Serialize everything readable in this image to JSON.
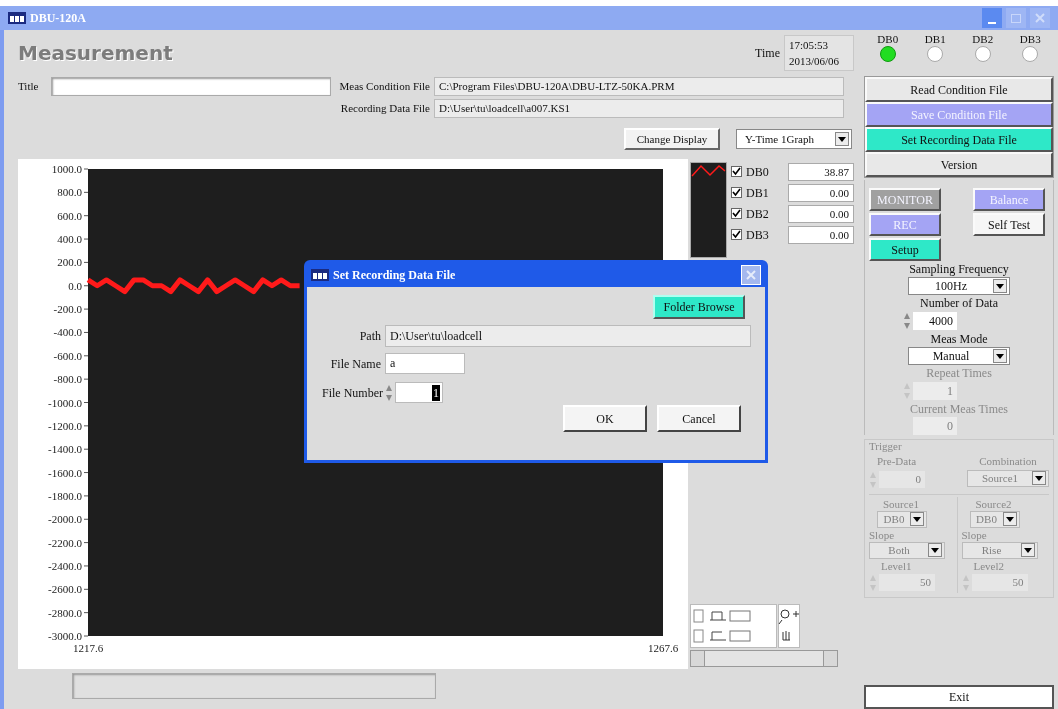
{
  "window": {
    "title": "DBU-120A"
  },
  "heading": "Measurement",
  "time": {
    "label": "Time",
    "clock": "17:05:53",
    "date": "2013/06/06"
  },
  "title_field": {
    "label": "Title"
  },
  "condition_file": {
    "label": "Meas Condition File",
    "value": "C:\\Program Files\\DBU-120A\\DBU-LTZ-50KA.PRM"
  },
  "recording_file": {
    "label": "Recording Data File",
    "value": "D:\\User\\tu\\loadcell\\a007.KS1"
  },
  "change_display": "Change Display",
  "display_mode": "Y-Time 1Graph",
  "chart_data": {
    "type": "line",
    "xlim": [
      1217.6,
      1267.6
    ],
    "ylim": [
      -3000,
      1000
    ],
    "xticks": [
      1217.6,
      1267.6
    ],
    "yticks": [
      {
        "value": 1000,
        "label": "1000.0"
      },
      {
        "value": 800,
        "label": "800.0"
      },
      {
        "value": 600,
        "label": "600.0"
      },
      {
        "value": 400,
        "label": "400.0"
      },
      {
        "value": 200,
        "label": "200.0"
      },
      {
        "value": 0,
        "label": "0.0"
      },
      {
        "value": -200,
        "label": "-200.0"
      },
      {
        "value": -400,
        "label": "-400.0"
      },
      {
        "value": -600,
        "label": "-600.0"
      },
      {
        "value": -800,
        "label": "-800.0"
      },
      {
        "value": -1000,
        "label": "-1000.0"
      },
      {
        "value": -1200,
        "label": "-1200.0"
      },
      {
        "value": -1400,
        "label": "-1400.0"
      },
      {
        "value": -1600,
        "label": "-1600.0"
      },
      {
        "value": -1800,
        "label": "-1800.0"
      },
      {
        "value": -2000,
        "label": "-2000.0"
      },
      {
        "value": -2200,
        "label": "-2200.0"
      },
      {
        "value": -2400,
        "label": "-2400.0"
      },
      {
        "value": -2600,
        "label": "-2600.0"
      },
      {
        "value": -2800,
        "label": "-2800.0"
      },
      {
        "value": -3000,
        "label": "-3000.0"
      }
    ],
    "x": [
      1217.6,
      1218.4,
      1219.2,
      1220.0,
      1220.8,
      1221.6,
      1222.4,
      1223.2,
      1224.0,
      1224.8,
      1225.6,
      1226.4,
      1227.2,
      1228.0,
      1228.8,
      1229.6,
      1230.4,
      1231.2,
      1232.0,
      1232.8,
      1233.6,
      1234.4,
      1235.2,
      1236.0
    ],
    "series": [
      {
        "color": "#ff1a1a",
        "values": [
          50,
          0,
          50,
          0,
          -50,
          50,
          50,
          0,
          0,
          -50,
          50,
          0,
          -50,
          50,
          -50,
          0,
          50,
          0,
          -50,
          50,
          0,
          50,
          0,
          0
        ]
      }
    ]
  },
  "legend_channels": [
    {
      "label": "DB0",
      "checked": true,
      "value": "38.87"
    },
    {
      "label": "DB1",
      "checked": true,
      "value": "0.00"
    },
    {
      "label": "DB2",
      "checked": true,
      "value": "0.00"
    },
    {
      "label": "DB3",
      "checked": true,
      "value": "0.00"
    }
  ],
  "channels": [
    {
      "label": "DB0",
      "on": true
    },
    {
      "label": "DB1",
      "on": false
    },
    {
      "label": "DB2",
      "on": false
    },
    {
      "label": "DB3",
      "on": false
    }
  ],
  "file_buttons": [
    {
      "label": "Read Condition File",
      "color": "#e8e8e8",
      "dimmed": false
    },
    {
      "label": "Save Condition File",
      "color": "#a4a4f4",
      "dimmed": true
    },
    {
      "label": "Set Recording Data File",
      "color": "#2ee8c8",
      "dimmed": false
    },
    {
      "label": "Version",
      "color": "#e8e8e8",
      "dimmed": false
    }
  ],
  "mode_buttons": [
    {
      "label": "MONITOR",
      "color": "#a0a0a0",
      "dimmed": true
    },
    {
      "label": "REC",
      "color": "#a4a4f4",
      "dimmed": true
    },
    {
      "label": "Setup",
      "color": "#2ee8c8",
      "dimmed": false
    },
    {
      "label": "Balance",
      "color": "#a4a4f4",
      "dimmed": true
    },
    {
      "label": "Self Test",
      "color": "#f6f6f6",
      "dimmed": false
    }
  ],
  "settings": [
    {
      "kind": "dropdown",
      "label": "Sampling Frequency",
      "value": "100Hz",
      "disabled": false
    },
    {
      "kind": "spinner",
      "label": "Number of Data",
      "value": "4000",
      "disabled": false
    },
    {
      "kind": "dropdown",
      "label": "Meas Mode",
      "value": "Manual",
      "disabled": false
    },
    {
      "kind": "spinner",
      "label": "Repeat Times",
      "value": "1",
      "disabled": true
    },
    {
      "kind": "readout",
      "label": "Current Meas Times",
      "value": "0",
      "disabled": true
    }
  ],
  "trigger": {
    "label": "Trigger",
    "disabled": true,
    "pre_data": {
      "label": "Pre-Data",
      "value": "0"
    },
    "combination": {
      "label": "Combination",
      "value": "Source1"
    },
    "sources": [
      {
        "label": "Source1",
        "value": "DB0",
        "slope_label": "Slope",
        "slope": "Both",
        "level_label": "Level1",
        "level": "50"
      },
      {
        "label": "Source2",
        "value": "DB0",
        "slope_label": "Slope",
        "slope": "Rise",
        "level_label": "Level2",
        "level": "50"
      }
    ]
  },
  "exit": "Exit",
  "dialog": {
    "title": "Set Recording Data File",
    "folder_browse": "Folder Browse",
    "path": {
      "label": "Path",
      "value": "D:\\User\\tu\\loadcell"
    },
    "file_name": {
      "label": "File Name",
      "value": "a"
    },
    "file_number": {
      "label": "File Number",
      "value": "1"
    },
    "buttons": [
      "OK",
      "Cancel"
    ]
  }
}
